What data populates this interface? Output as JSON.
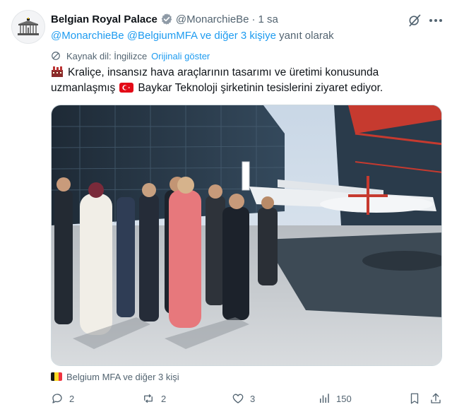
{
  "author": {
    "name": "Belgian Royal Palace",
    "handle": "@MonarchieBe",
    "separator": "·",
    "time": "1 sa"
  },
  "reply": {
    "mention1": "@MonarchieBe",
    "mention2": "@BelgiumMFA",
    "others": "ve diğer 3 kişiye",
    "suffix": "yanıt olarak"
  },
  "translation": {
    "source": "Kaynak dil: İngilizce",
    "show_original": "Orijinali göster"
  },
  "tweet": {
    "line1": "Kraliçe, insansız hava araçlarının tasarımı ve üretimi konusunda",
    "line2a": "uzmanlaşmış",
    "line2b": "Baykar Teknoloji şirketinin tesislerini ziyaret ediyor."
  },
  "tagged": "Belgium MFA ve diğer 3 kişi",
  "actions": {
    "replies": "2",
    "reposts": "2",
    "likes": "3",
    "views": "150"
  },
  "icons": [
    "palace-logo-icon",
    "verified-badge-icon",
    "grok-icon",
    "more-icon",
    "globe-icon",
    "factory-emoji-icon",
    "turkey-flag-icon",
    "belgium-flag-icon",
    "reply-icon",
    "repost-icon",
    "like-icon",
    "views-icon",
    "bookmark-icon",
    "share-icon"
  ],
  "colors": {
    "accent": "#1d9bf0",
    "secondary_text": "#536471",
    "verified_gold": "#e2b719"
  }
}
